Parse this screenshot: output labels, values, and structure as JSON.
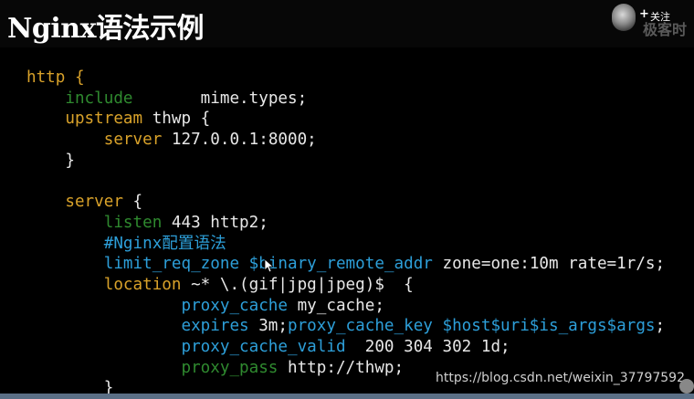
{
  "header": {
    "title": "Nginx语法示例",
    "follow": {
      "plus": "+",
      "label": "关注",
      "logo_text": "极客时"
    }
  },
  "code": {
    "lines": [
      [
        {
          "t": "http {",
          "c": "kw"
        }
      ],
      [
        {
          "t": "    include",
          "c": "dim"
        },
        {
          "t": "       mime.types;",
          "c": "plain"
        }
      ],
      [
        {
          "t": "    upstream",
          "c": "kw"
        },
        {
          "t": " thwp {",
          "c": "plain"
        }
      ],
      [
        {
          "t": "        server",
          "c": "kw"
        },
        {
          "t": " 127.0.0.1:8000;",
          "c": "plain"
        }
      ],
      [
        {
          "t": "    }",
          "c": "plain"
        }
      ],
      [
        {
          "t": "",
          "c": "plain"
        }
      ],
      [
        {
          "t": "    server",
          "c": "kw"
        },
        {
          "t": " {",
          "c": "plain"
        }
      ],
      [
        {
          "t": "        listen",
          "c": "dim"
        },
        {
          "t": " 443 http2;",
          "c": "plain"
        }
      ],
      [
        {
          "t": "        #Nginx配置语法",
          "c": "blue"
        }
      ],
      [
        {
          "t": "        limit_req_zone $binary_remote_addr",
          "c": "blue"
        },
        {
          "t": " zone=one:10m rate=1r/s;",
          "c": "plain"
        }
      ],
      [
        {
          "t": "        location",
          "c": "kw"
        },
        {
          "t": " ~* \\.(gif|jpg|jpeg)$  {",
          "c": "plain"
        }
      ],
      [
        {
          "t": "                proxy_cache",
          "c": "blue"
        },
        {
          "t": " my_cache;",
          "c": "plain"
        }
      ],
      [
        {
          "t": "                expires",
          "c": "blue"
        },
        {
          "t": " 3m;",
          "c": "plain"
        },
        {
          "t": "proxy_cache_key $host$uri$is_args$args",
          "c": "blue"
        },
        {
          "t": ";",
          "c": "plain"
        }
      ],
      [
        {
          "t": "                proxy_cache_valid",
          "c": "blue"
        },
        {
          "t": "  200 304 302 1d;",
          "c": "plain"
        }
      ],
      [
        {
          "t": "                proxy_pass",
          "c": "dim"
        },
        {
          "t": " http://thwp;",
          "c": "plain"
        }
      ],
      [
        {
          "t": "        }",
          "c": "plain"
        }
      ]
    ]
  },
  "watermark": {
    "url": "https://blog.csdn.net/weixin_37797592"
  },
  "colors": {
    "keyword": "#d9a22a",
    "directive_dim": "#2f8a2f",
    "blue": "#2d9fd9",
    "plain": "#e8e8e8",
    "background": "#000000"
  }
}
